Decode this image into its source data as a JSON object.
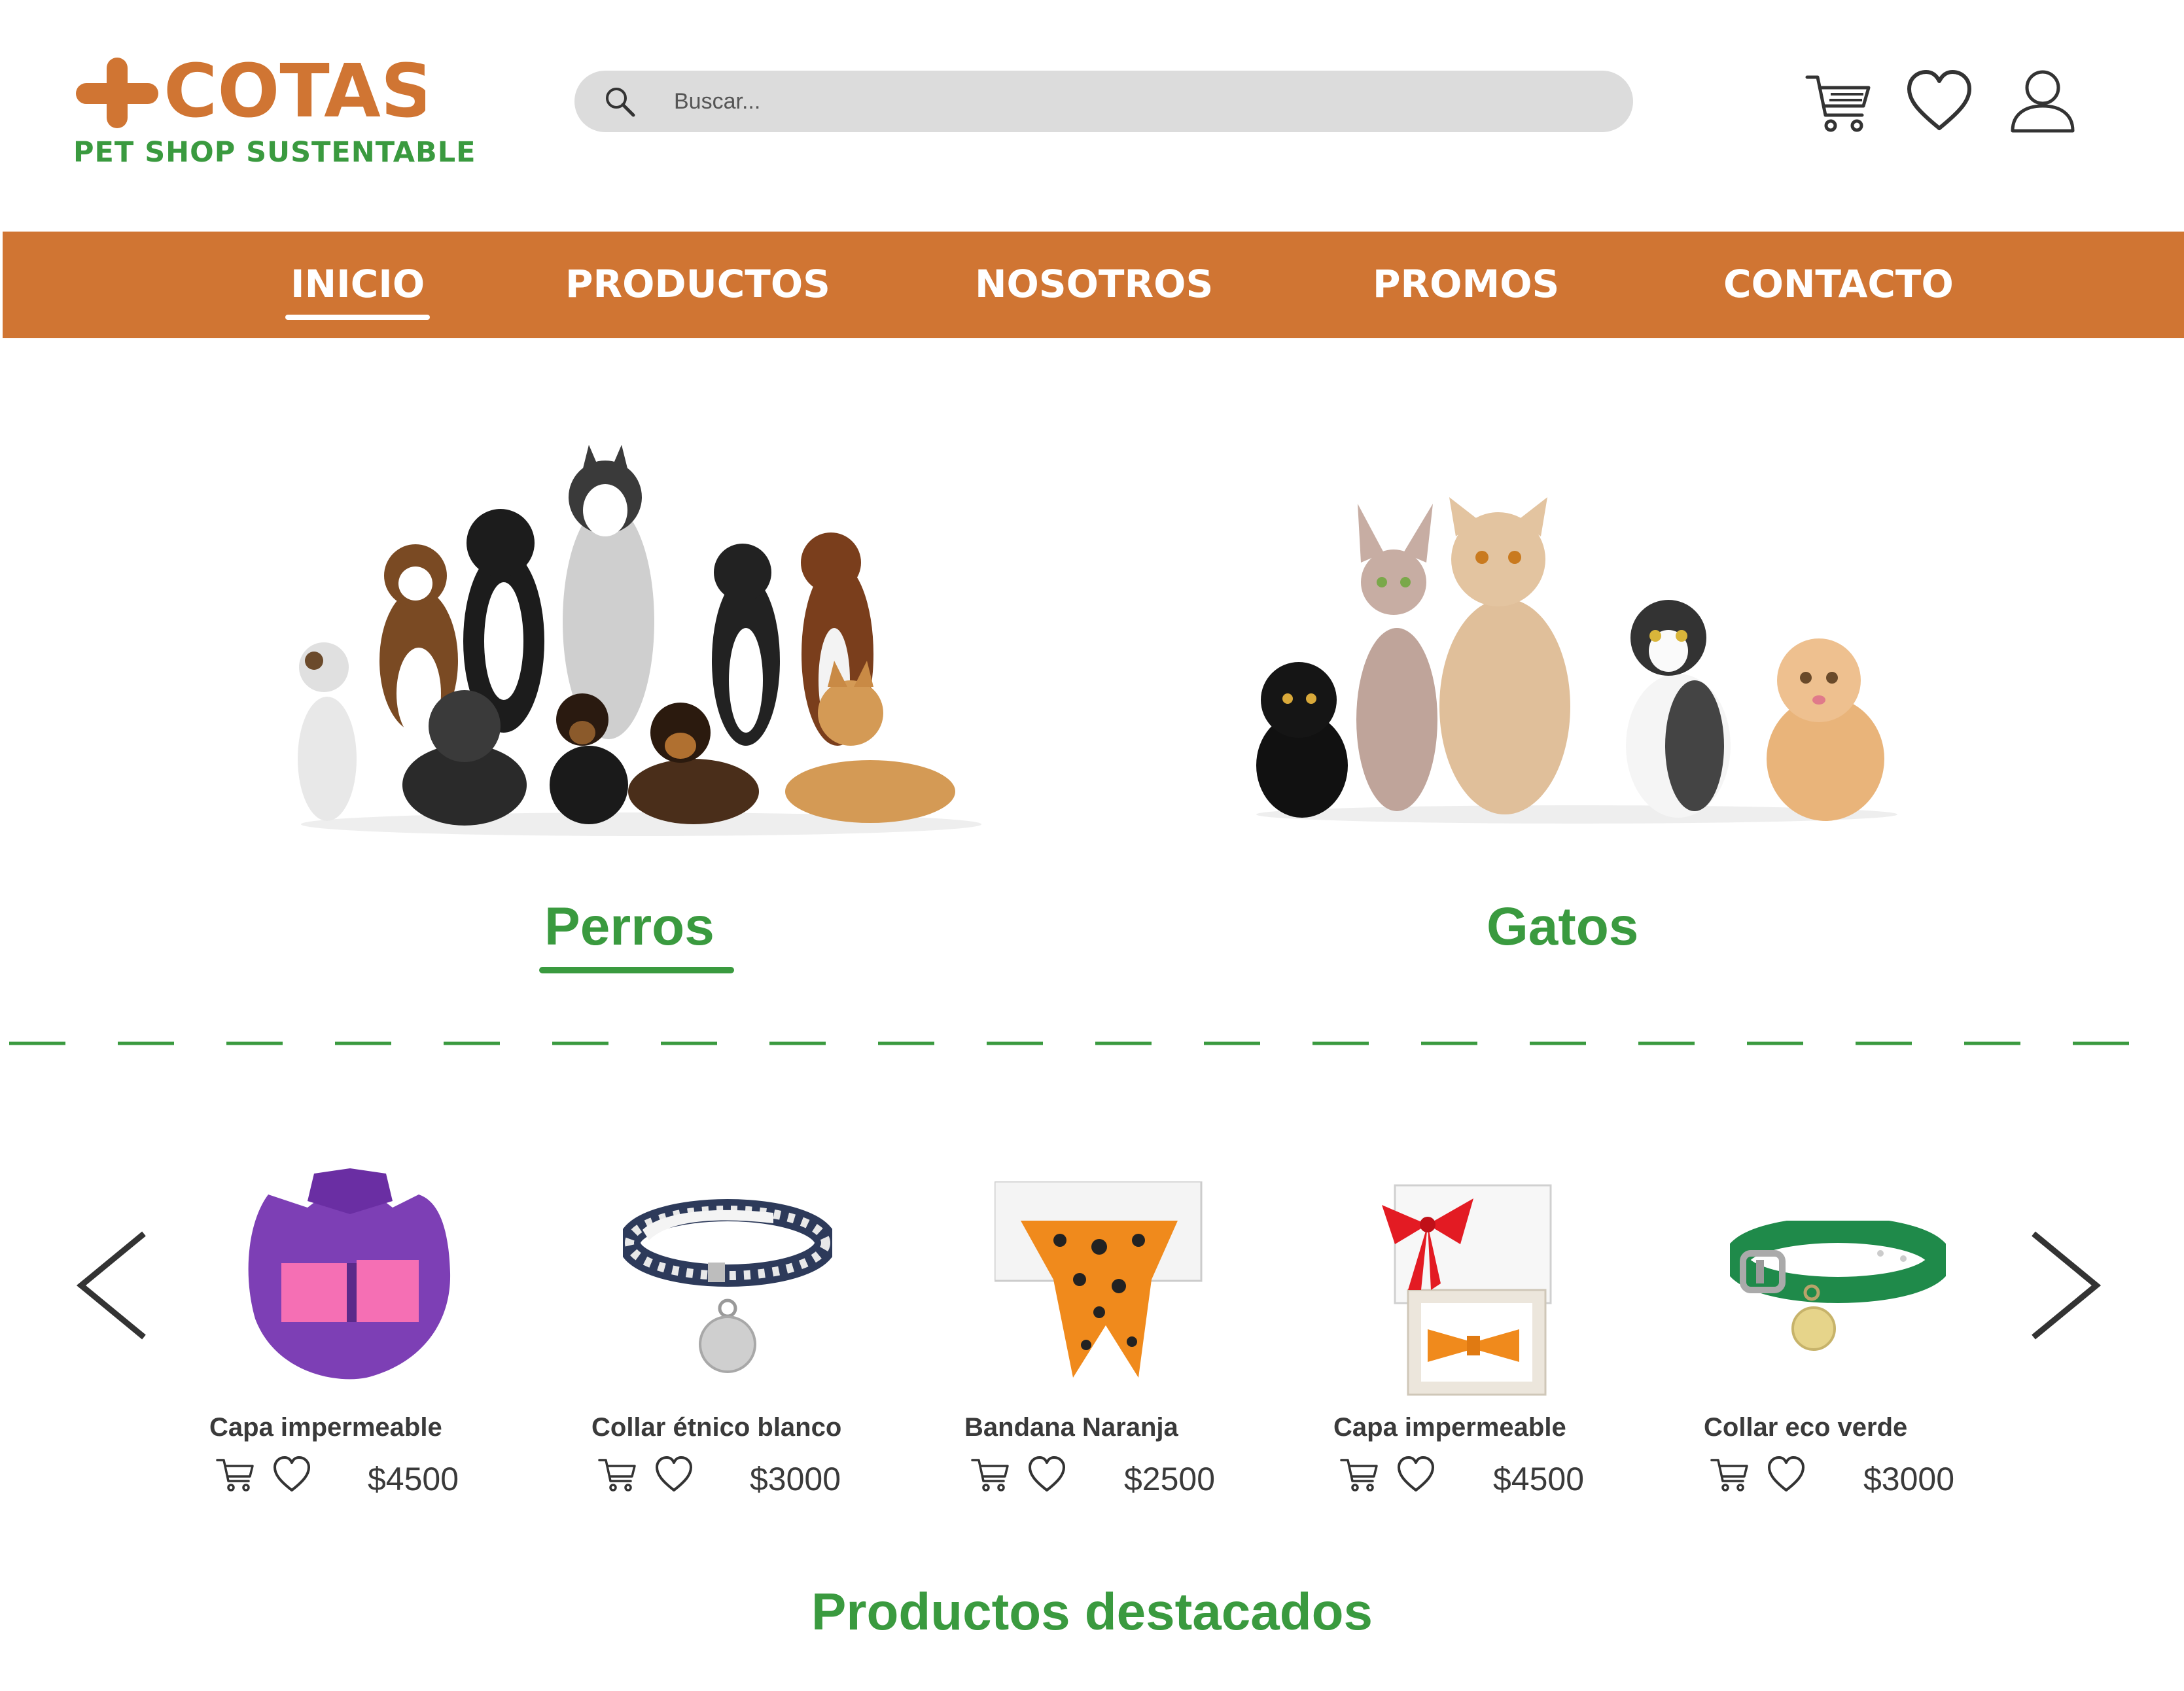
{
  "brand": {
    "name": "COTAS",
    "tagline": "PET SHOP SUSTENTABLE",
    "primary_color": "#d07533",
    "accent_color": "#3a9a3f"
  },
  "search": {
    "placeholder": "Buscar..."
  },
  "header_icons": [
    "cart-icon",
    "heart-icon",
    "user-icon"
  ],
  "nav": {
    "items": [
      {
        "label": "INICIO",
        "active": true
      },
      {
        "label": "PRODUCTOS",
        "active": false
      },
      {
        "label": "NOSOTROS",
        "active": false
      },
      {
        "label": "PROMOS",
        "active": false
      },
      {
        "label": "CONTACTO",
        "active": false
      }
    ]
  },
  "categories": [
    {
      "label": "Perros",
      "active": true
    },
    {
      "label": "Gatos",
      "active": false
    }
  ],
  "products": [
    {
      "name": "Capa impermeable",
      "price": "$4500"
    },
    {
      "name": "Collar étnico blanco",
      "price": "$3000"
    },
    {
      "name": "Bandana Naranja",
      "price": "$2500"
    },
    {
      "name": "Capa impermeable",
      "price": "$4500"
    },
    {
      "name": "Collar eco verde",
      "price": "$3000"
    }
  ],
  "featured_title": "Productos destacados"
}
